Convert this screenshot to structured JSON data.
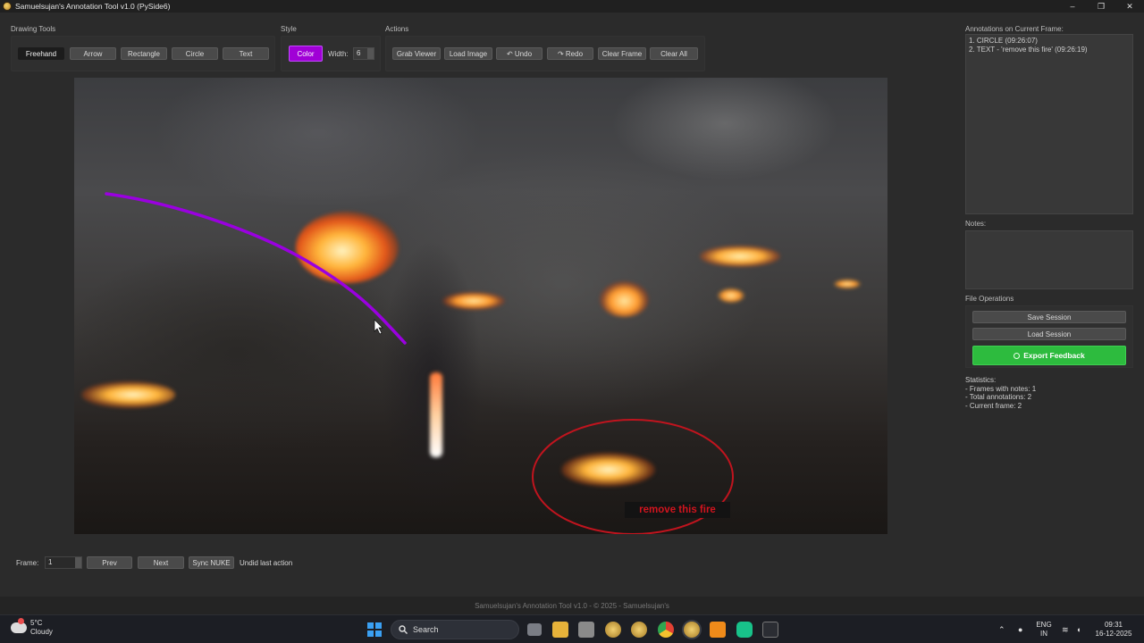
{
  "window": {
    "title": "Samuelsujan's Annotation Tool v1.0 (PySide6)",
    "controls": [
      "–",
      "❐",
      "✕"
    ]
  },
  "sections": {
    "drawing_tools": "Drawing Tools",
    "style": "Style",
    "actions": "Actions"
  },
  "drawing_tools": {
    "freehand": "Freehand",
    "arrow": "Arrow",
    "rectangle": "Rectangle",
    "circle": "Circle",
    "text": "Text",
    "active": "Freehand"
  },
  "style": {
    "color_label": "Color",
    "color_value": "#a000d6",
    "width_label": "Width:",
    "width_value": "6"
  },
  "actions": {
    "grab_viewer": "Grab Viewer",
    "load_image": "Load Image",
    "undo": "↶ Undo",
    "redo": "↷ Redo",
    "clear_frame": "Clear Frame",
    "clear_all": "Clear All"
  },
  "viewer": {
    "annotation_text": "remove this fire",
    "circle_color": "#c0141e",
    "stroke_color": "#9a00e0"
  },
  "right_panel": {
    "annotations_title": "Annotations on Current Frame:",
    "annotations": [
      "1. CIRCLE (09:26:07)",
      "2. TEXT - 'remove this fire' (09:26:19)"
    ],
    "notes_title": "Notes:",
    "file_ops_title": "File Operations",
    "save_session": "Save Session",
    "load_session": "Load Session",
    "export_feedback": "Export Feedback",
    "statistics": [
      "Statistics:",
      "- Frames with notes: 1",
      "- Total annotations: 2",
      "- Current frame: 2"
    ]
  },
  "bottom": {
    "frame_label": "Frame:",
    "frame_value": "1",
    "prev": "Prev",
    "next": "Next",
    "sync_nuke": "Sync NUKE",
    "status": "Undid last action"
  },
  "footer": "Samuelsujan's Annotation Tool v1.0 - © 2025 - Samuelsujan's",
  "taskbar": {
    "weather_temp": "5°C",
    "weather_desc": "Cloudy",
    "search_placeholder": "Search",
    "lang_top": "ENG",
    "lang_bottom": "IN",
    "time": "09:31",
    "date": "16-12-2025"
  }
}
